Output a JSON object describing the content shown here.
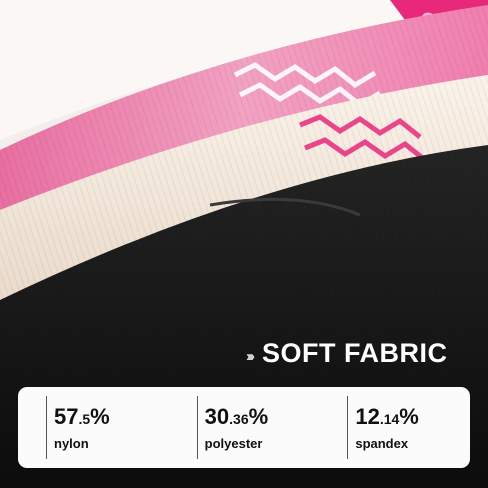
{
  "headline": {
    "chevrons": "›››",
    "title": "SOFT FABRIC"
  },
  "materials": [
    {
      "major": "57",
      "minor": ".5",
      "pct": "%",
      "name": "nylon"
    },
    {
      "major": "30",
      "minor": ".36",
      "pct": "%",
      "name": "polyester"
    },
    {
      "major": "12",
      "minor": ".14",
      "pct": "%",
      "name": "spandex"
    }
  ],
  "colors": {
    "pink": "#f08cb3",
    "hot_pink": "#e8287a",
    "cream": "#f3e7dc",
    "black": "#141414",
    "panel": "#fbfbfb"
  }
}
